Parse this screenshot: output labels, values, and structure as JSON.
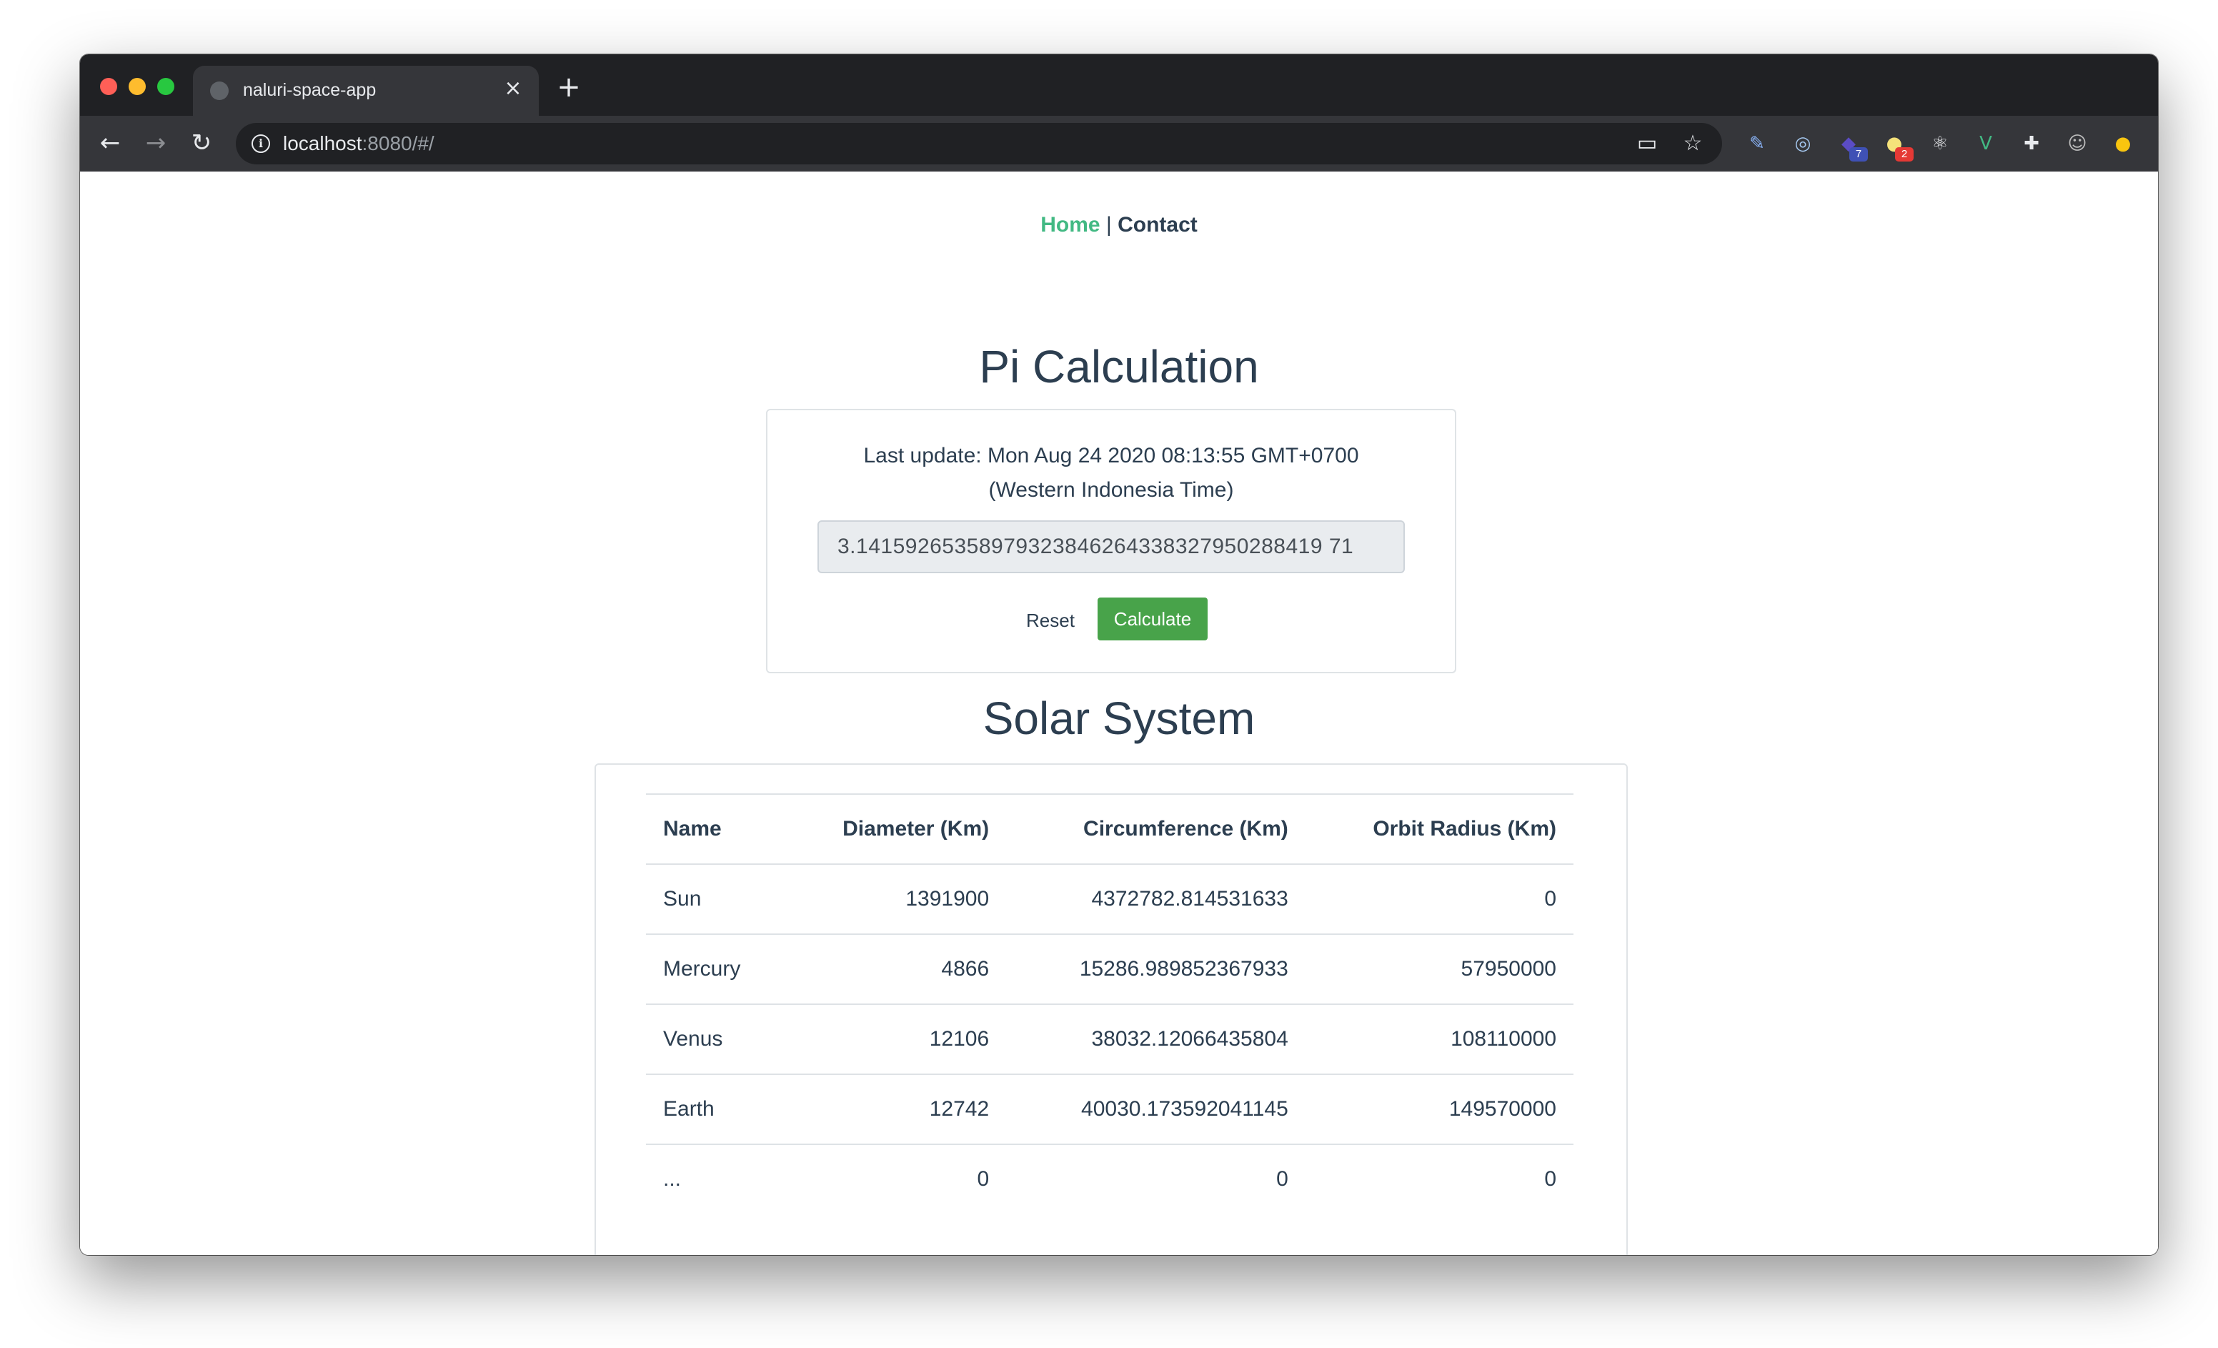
{
  "browser": {
    "tab_title": "naluri-space-app",
    "tab_close": "×",
    "new_tab": "+",
    "url_host": "localhost",
    "url_rest": ":8080/#/",
    "extensions": [
      {
        "name": "pen-extension",
        "glyph": "✎",
        "color": "#8ab4f8"
      },
      {
        "name": "ring-extension",
        "glyph": "◎",
        "color": "#a5c8f0"
      },
      {
        "name": "hat-extension",
        "glyph": "◆",
        "color": "#5b4cc4",
        "badge": "7",
        "badge_color": "#3f51b5"
      },
      {
        "name": "bulb-extension",
        "glyph": "●",
        "color": "#f5e27a",
        "badge": "2",
        "badge_color": "#e53935"
      },
      {
        "name": "react-devtools-extension",
        "glyph": "⚛",
        "color": "#e8eaed"
      },
      {
        "name": "vue-devtools-extension",
        "glyph": "V",
        "color": "#42b983"
      },
      {
        "name": "puzzle-extensions-icon",
        "glyph": "✚",
        "color": "#e8eaed"
      },
      {
        "name": "profile-avatar",
        "glyph": "☺",
        "color": "#bdbdbd"
      },
      {
        "name": "yellow-status-extension",
        "glyph": "●",
        "color": "#f9c50f"
      }
    ]
  },
  "nav": {
    "home": "Home",
    "separator": "|",
    "contact": "Contact"
  },
  "pi": {
    "title": "Pi Calculation",
    "last_update_line1": "Last update: Mon Aug 24 2020 08:13:55 GMT+0700",
    "last_update_line2": "(Western Indonesia Time)",
    "value": "3.14159265358979323846264338327950288419 71",
    "reset_label": "Reset",
    "calculate_label": "Calculate"
  },
  "solar": {
    "title": "Solar System",
    "columns": [
      "Name",
      "Diameter (Km)",
      "Circumference (Km)",
      "Orbit Radius (Km)"
    ],
    "rows": [
      [
        "Sun",
        "1391900",
        "4372782.814531633",
        "0"
      ],
      [
        "Mercury",
        "4866",
        "15286.989852367933",
        "57950000"
      ],
      [
        "Venus",
        "12106",
        "38032.12066435804",
        "108110000"
      ],
      [
        "Earth",
        "12742",
        "40030.173592041145",
        "149570000"
      ],
      [
        "...",
        "0",
        "0",
        "0"
      ]
    ]
  }
}
